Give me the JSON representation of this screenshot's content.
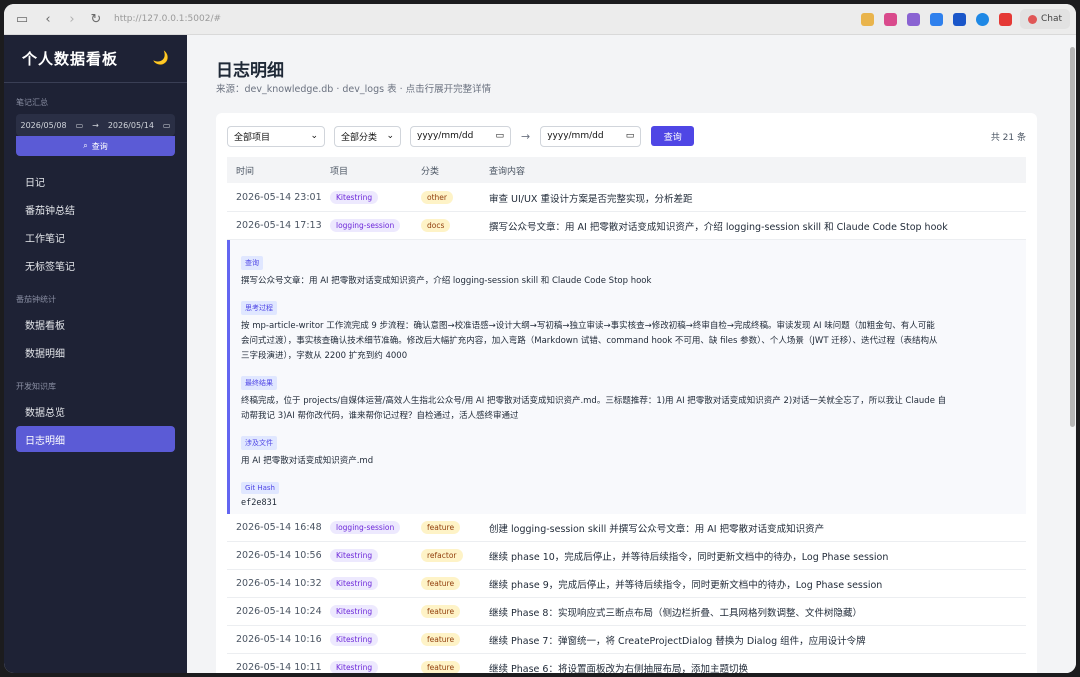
{
  "browser": {
    "url": "http://127.0.0.1:5002/#",
    "chat_label": "Chat"
  },
  "sidebar": {
    "title": "个人数据看板",
    "moon_icon": "🌙",
    "sections": {
      "notes": "笔记汇总",
      "pomodoro": "番茄钟统计",
      "devkb": "开发知识库"
    },
    "date_from": "2026/05/08",
    "date_to": "2026/05/14",
    "date_sep": "→",
    "query_label": "查询",
    "items": [
      {
        "label": "日记"
      },
      {
        "label": "番茄钟总结"
      },
      {
        "label": "工作笔记"
      },
      {
        "label": "无标签笔记"
      },
      {
        "label": "数据看板"
      },
      {
        "label": "数据明细"
      },
      {
        "label": "数据总览"
      },
      {
        "label": "日志明细"
      }
    ]
  },
  "main": {
    "title": "日志明细",
    "subtitle": "来源：dev_knowledge.db · dev_logs 表 · 点击行展开完整详情",
    "filters": {
      "project": "全部项目",
      "category": "全部分类",
      "date_placeholder": "yyyy/mm/dd",
      "date_sep": "→",
      "query": "查询",
      "count": "共 21 条"
    },
    "columns": [
      "时间",
      "项目",
      "分类",
      "查询内容"
    ],
    "rows": [
      {
        "time": "2026-05-14 23:01",
        "project": "Kitestring",
        "category": "other",
        "query": "审查 UI/UX 重设计方案是否完整实现，分析差距"
      },
      {
        "time": "2026-05-14 17:13",
        "project": "logging-session",
        "category": "docs",
        "query": "撰写公众号文章：用 AI 把零散对话变成知识资产，介绍 logging-session skill 和 Claude Code Stop hook"
      },
      {
        "time": "2026-05-14 16:48",
        "project": "logging-session",
        "category": "feature",
        "query": "创建 logging-session skill 并撰写公众号文章：用 AI 把零散对话变成知识资产"
      },
      {
        "time": "2026-05-14 10:56",
        "project": "Kitestring",
        "category": "refactor",
        "query": "继续 phase 10，完成后停止，并等待后续指令，同时更新文档中的待办，Log Phase session"
      },
      {
        "time": "2026-05-14 10:32",
        "project": "Kitestring",
        "category": "feature",
        "query": "继续 phase 9，完成后停止，并等待后续指令，同时更新文档中的待办，Log Phase session"
      },
      {
        "time": "2026-05-14 10:24",
        "project": "Kitestring",
        "category": "feature",
        "query": "继续 Phase 8：实现响应式三断点布局（侧边栏折叠、工具网格列数调整、文件树隐藏）"
      },
      {
        "time": "2026-05-14 10:16",
        "project": "Kitestring",
        "category": "feature",
        "query": "继续 Phase 7：弹窗统一，将 CreateProjectDialog 替换为 Dialog 组件，应用设计令牌"
      },
      {
        "time": "2026-05-14 10:11",
        "project": "Kitestring",
        "category": "feature",
        "query": "继续 Phase 6：将设置面板改为右侧抽屉布局，添加主题切换"
      }
    ],
    "detail": {
      "query_label": "查询",
      "query_text": "撰写公众号文章：用 AI 把零散对话变成知识资产，介绍 logging-session skill 和 Claude Code Stop hook",
      "thinking_label": "思考过程",
      "thinking_line1": "按 mp-article-writor 工作流完成 9 步流程：确认意图→校准语感→设计大纲→写初稿→独立审读→事实核查→修改初稿→终审自检→完成终稿。审读发现 AI 味问题（加粗金句、有人可能",
      "thinking_line2": "会问式过渡），事实核查确认技术细节准确。修改后大幅扩充内容，加入弯路（Markdown 试错、command hook 不可用、缺 files 参数）、个人场景（JWT 迁移）、迭代过程（表结构从",
      "thinking_line3": "三字段演进），字数从 2200 扩充到约 4000",
      "result_label": "最终结果",
      "result_line1": "终稿完成，位于 projects/自媒体运营/高效人生指北公众号/用 AI 把零散对话变成知识资产.md。三标题推荐：1)用 AI 把零散对话变成知识资产 2)对话一关就全忘了，所以我让 Claude 自",
      "result_line2": "动帮我记 3)AI 帮你改代码，谁来帮你记过程？自检通过，活人感终审通过",
      "files_label": "涉及文件",
      "files_text": "用 AI 把零散对话变成知识资产.md",
      "hash_label": "Git Hash",
      "hash_text": "ef2e831"
    }
  }
}
